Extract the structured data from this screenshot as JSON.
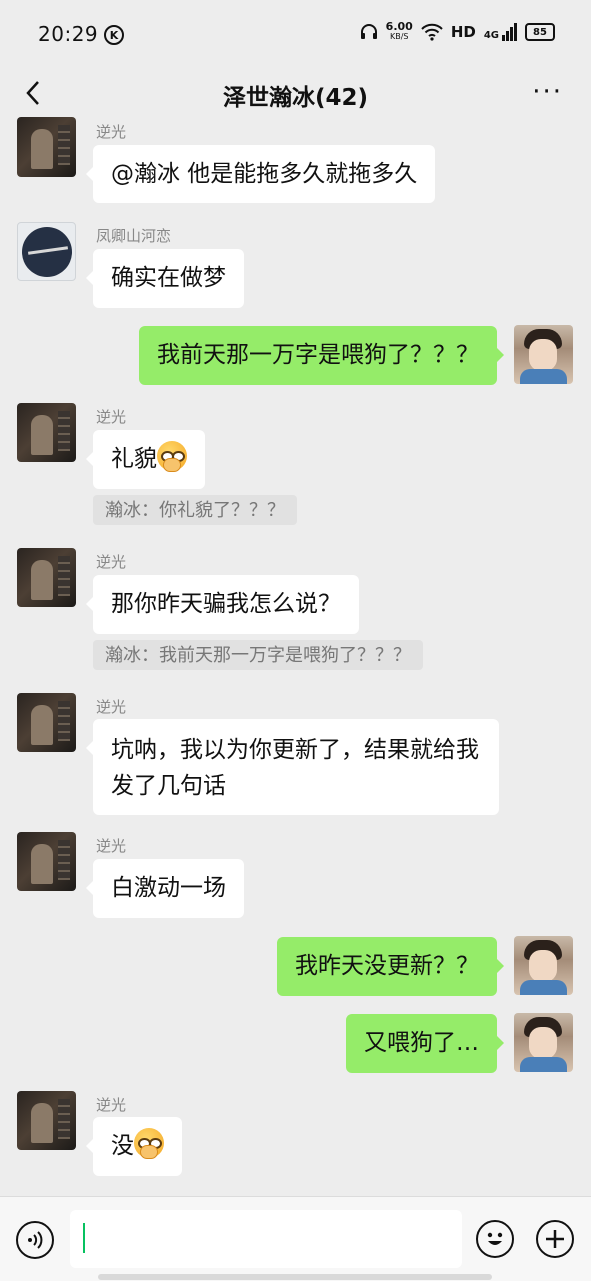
{
  "status": {
    "time": "20:29",
    "app_badge": "K",
    "net_speed_value": "6.00",
    "net_speed_unit": "KB/S",
    "hd": "HD",
    "signal": "4G",
    "battery": "85"
  },
  "header": {
    "title": "泽世瀚冰(42)",
    "more": "···"
  },
  "messages": [
    {
      "sender": "逆光",
      "text": "@瀚冰  他是能拖多久就拖多久",
      "side": "left"
    },
    {
      "sender": "凤卿山河恋",
      "text": "确实在做梦",
      "side": "left"
    },
    {
      "text": "我前天那一万字是喂狗了？？？",
      "side": "right"
    },
    {
      "sender": "逆光",
      "text": "礼貌",
      "emoji": "smirk-emoji",
      "quote": "瀚冰：你礼貌了？？？",
      "side": "left"
    },
    {
      "sender": "逆光",
      "text": "那你昨天骗我怎么说？",
      "quote": "瀚冰：我前天那一万字是喂狗了？？？",
      "side": "left"
    },
    {
      "sender": "逆光",
      "text": "坑呐，我以为你更新了，结果就给我发了几句话",
      "side": "left"
    },
    {
      "sender": "逆光",
      "text": "白激动一场",
      "side": "left"
    },
    {
      "text": "我昨天没更新？？",
      "side": "right"
    },
    {
      "text": "又喂狗了…",
      "side": "right"
    },
    {
      "sender": "逆光",
      "text": "没",
      "emoji": "smirk-emoji",
      "side": "left"
    }
  ],
  "input": {
    "value": ""
  },
  "colors": {
    "background": "#ededed",
    "self_bubble": "#95ec69",
    "other_bubble": "#ffffff",
    "caret": "#07c160"
  }
}
